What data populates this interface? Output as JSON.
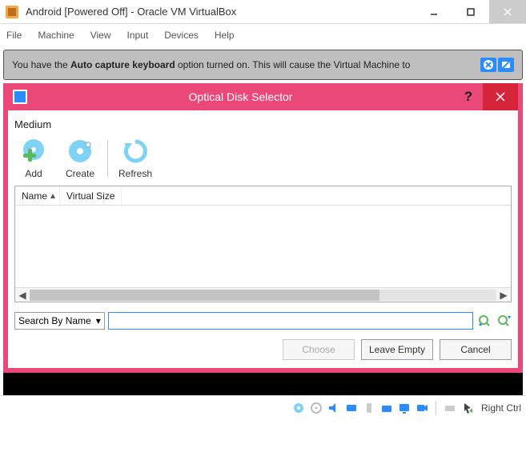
{
  "mainWindow": {
    "title": "Android [Powered Off] - Oracle VM VirtualBox"
  },
  "menu": {
    "file": "File",
    "machine": "Machine",
    "view": "View",
    "input": "Input",
    "devices": "Devices",
    "help": "Help"
  },
  "notification": {
    "prefix": "You have the ",
    "bold": "Auto capture keyboard",
    "suffix": " option turned on. This will cause the Virtual Machine to"
  },
  "dialog": {
    "title": "Optical Disk Selector",
    "mediumLabel": "Medium",
    "toolbar": {
      "add": "Add",
      "create": "Create",
      "refresh": "Refresh"
    },
    "columns": {
      "name": "Name",
      "vsize": "Virtual Size"
    },
    "searchMode": "Search By Name",
    "searchValue": "",
    "buttons": {
      "choose": "Choose",
      "leaveEmpty": "Leave Empty",
      "cancel": "Cancel"
    }
  },
  "statusbar": {
    "hostKey": "Right Ctrl"
  }
}
